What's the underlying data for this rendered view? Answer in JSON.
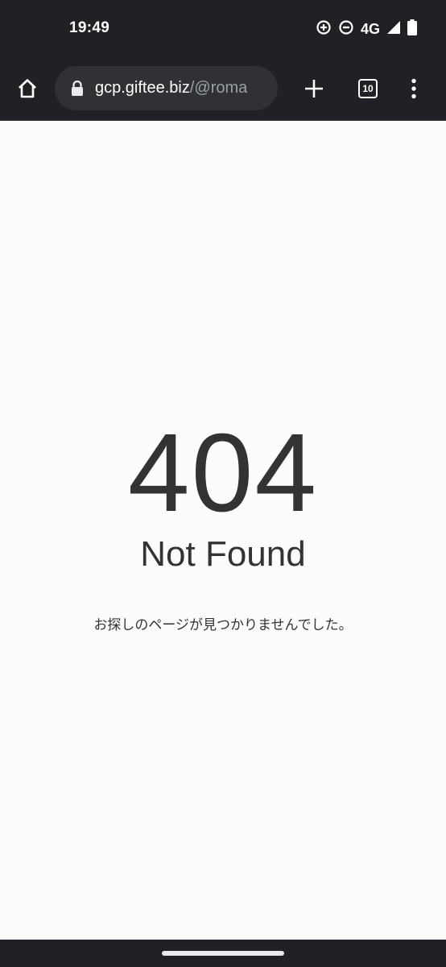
{
  "status_bar": {
    "time": "19:49",
    "network": "4G",
    "icons": [
      "data-saver-icon",
      "do-not-disturb-icon",
      "signal-icon",
      "battery-icon"
    ]
  },
  "toolbar": {
    "url_host": "gcp.giftee.biz",
    "url_path": "/@roma",
    "tab_count": "10",
    "icons": [
      "home-icon",
      "lock-icon",
      "plus-icon",
      "more-vert-icon"
    ]
  },
  "page": {
    "error_code": "404",
    "error_title": "Not Found",
    "message": "お探しのページが見つかりませんでした。"
  },
  "colors": {
    "chrome_bar": "#202124",
    "omnibox": "#303134",
    "page_background": "#fcfcfc",
    "text": "#333333"
  }
}
